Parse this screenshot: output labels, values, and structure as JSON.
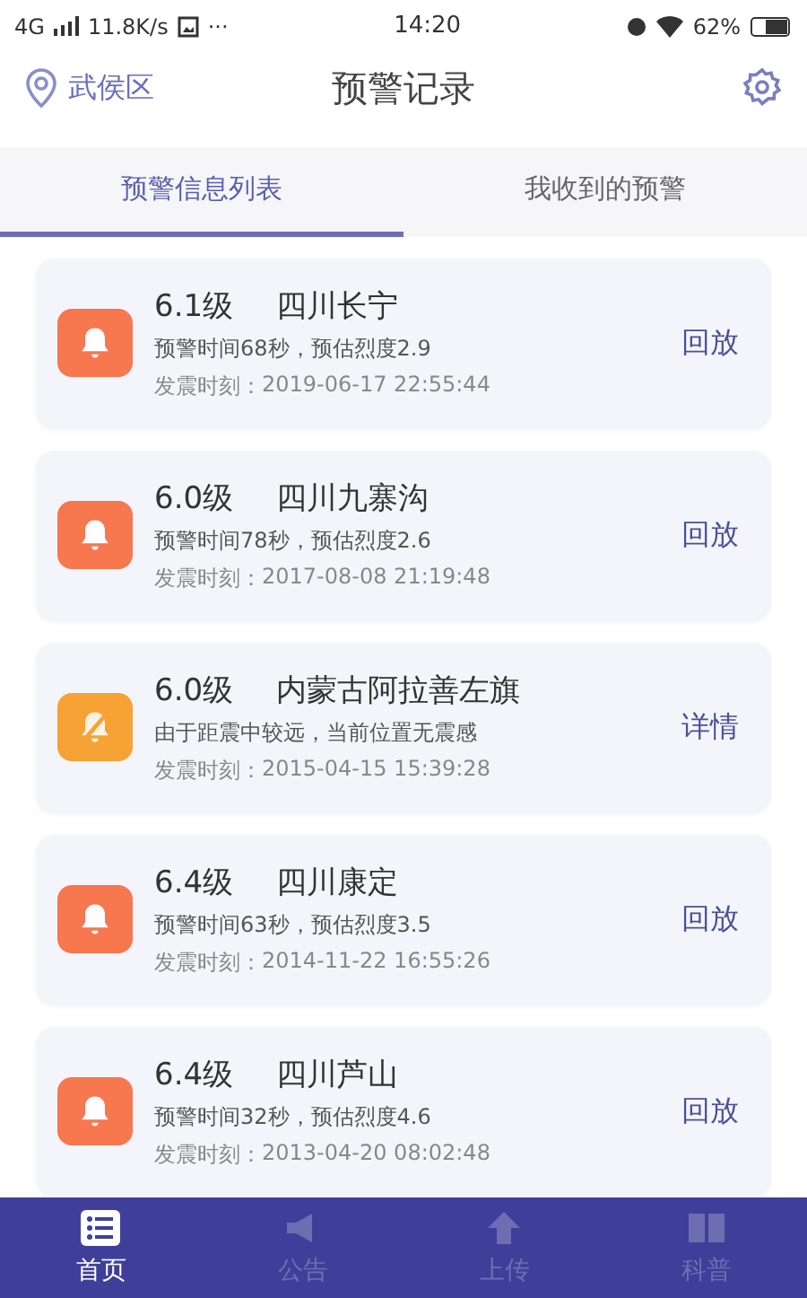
{
  "status_bar": {
    "network": "4G",
    "speed": "11.8K/s",
    "more": "···",
    "time": "14:20",
    "battery": "62%"
  },
  "header": {
    "location": "武侯区",
    "title": "预警记录"
  },
  "tabs": [
    {
      "label": "预警信息列表",
      "selected": true
    },
    {
      "label": "我收到的预警",
      "selected": false
    }
  ],
  "records": [
    {
      "kind": "alert",
      "magnitude": "6.1级",
      "place": "四川长宁",
      "detail": "预警时间68秒，预估烈度2.9",
      "time_label": "发震时刻：",
      "time": "2019-06-17 22:55:44",
      "action": "回放"
    },
    {
      "kind": "alert",
      "magnitude": "6.0级",
      "place": "四川九寨沟",
      "detail": "预警时间78秒，预估烈度2.6",
      "time_label": "发震时刻：",
      "time": "2017-08-08 21:19:48",
      "action": "回放"
    },
    {
      "kind": "muted",
      "magnitude": "6.0级",
      "place": "内蒙古阿拉善左旗",
      "detail": "由于距震中较远，当前位置无震感",
      "time_label": "发震时刻：",
      "time": "2015-04-15 15:39:28",
      "action": "详情"
    },
    {
      "kind": "alert",
      "magnitude": "6.4级",
      "place": "四川康定",
      "detail": "预警时间63秒，预估烈度3.5",
      "time_label": "发震时刻：",
      "time": "2014-11-22 16:55:26",
      "action": "回放"
    },
    {
      "kind": "alert",
      "magnitude": "6.4级",
      "place": "四川芦山",
      "detail": "预警时间32秒，预估烈度4.6",
      "time_label": "发震时刻：",
      "time": "2013-04-20 08:02:48",
      "action": "回放"
    }
  ],
  "nav": [
    {
      "kind": "list",
      "label": "首页",
      "selected": true
    },
    {
      "kind": "notice",
      "label": "公告",
      "selected": false
    },
    {
      "kind": "upload",
      "label": "上传",
      "selected": false
    },
    {
      "kind": "book",
      "label": "科普",
      "selected": false
    }
  ]
}
